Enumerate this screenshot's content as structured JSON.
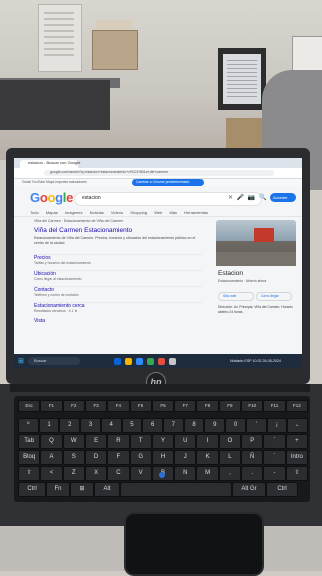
{
  "browser": {
    "tab_title": "estacion - Buscar con Google",
    "address": "google.com/search?q=estacion+estacionamiento+vi%C3%B1a+del+carmen",
    "bookmarks_text": "Gmail  YouTube  Maps  Importar marcadores",
    "bookmarks_button": "Cambiar a Chrome predeterminado"
  },
  "google": {
    "logo_letters": [
      {
        "char": "G",
        "color": "#4285F4"
      },
      {
        "char": "o",
        "color": "#EA4335"
      },
      {
        "char": "o",
        "color": "#FBBC05"
      },
      {
        "char": "g",
        "color": "#4285F4"
      },
      {
        "char": "l",
        "color": "#34A853"
      },
      {
        "char": "e",
        "color": "#EA4335"
      }
    ],
    "query": "estacion",
    "search_icons": "✕ 🎤 📷 🔍",
    "sign_in": "Acceder",
    "filters": "Todo  Mapas  Imágenes  Noticias  Videos  Shopping  Web  Más  Herramientas"
  },
  "results": {
    "site_header": "Viña del Carmen · Estacionamiento de Viña del Carmen",
    "title": "Viña del Carmen Estacionamiento",
    "description": "Estacionamiento de Viña del Carmen. Precios, horarios y ubicación del estacionamiento público en el centro de la ciudad.",
    "items": [
      {
        "link": "Precios",
        "sub": "Tarifas y horarios del estacionamiento"
      },
      {
        "link": "Ubicación",
        "sub": "Cómo llegar al estacionamiento"
      },
      {
        "link": "Contacto",
        "sub": "Teléfono y correo de contacto"
      },
      {
        "link": "Estacionamiento cerca",
        "sub": "Resultados cercanos · 4,1 ★"
      }
    ],
    "more_link": "Vista"
  },
  "knowledge_panel": {
    "name": "Estacion",
    "description": "Estacionamiento · Abierto ahora",
    "btn_website": "Sitio web",
    "btn_directions": "Cómo llegar",
    "address": "Dirección: Av. Principal, Viña del Carmen. Horario: abierto 24 horas."
  },
  "taskbar": {
    "start_glyph": "⊞",
    "search_text": "Buscar",
    "apps": [
      "#0a64d6",
      "#f5b400",
      "#2d8cff",
      "#34a853",
      "#e74c3c",
      "#c6c6c6"
    ],
    "tray": "Nublado  ESP  10:32  28-05-2024"
  },
  "laptop": {
    "brand": "hp"
  },
  "keyboard": {
    "rows": [
      [
        "Esc",
        "F1",
        "F2",
        "F3",
        "F4",
        "F5",
        "F6",
        "F7",
        "F8",
        "F9",
        "F10",
        "F11",
        "F12"
      ],
      [
        "º",
        "1",
        "2",
        "3",
        "4",
        "5",
        "6",
        "7",
        "8",
        "9",
        "0",
        "'",
        "¡",
        "←"
      ],
      [
        "Tab",
        "Q",
        "W",
        "E",
        "R",
        "T",
        "Y",
        "U",
        "I",
        "O",
        "P",
        "`",
        "+"
      ],
      [
        "Bloq",
        "A",
        "S",
        "D",
        "F",
        "G",
        "H",
        "J",
        "K",
        "L",
        "Ñ",
        "´",
        "Intro"
      ],
      [
        "⇧",
        "<",
        "Z",
        "X",
        "C",
        "V",
        "B",
        "N",
        "M",
        ",",
        ".",
        "-",
        "⇧"
      ],
      [
        "Ctrl",
        "Fn",
        "⊞",
        "Alt",
        "",
        "Alt Gr",
        "Ctrl"
      ]
    ]
  }
}
